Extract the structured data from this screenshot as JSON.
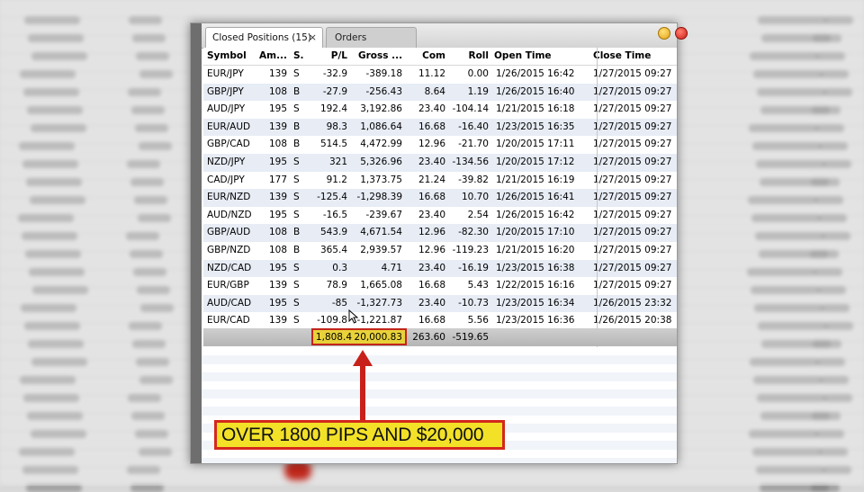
{
  "tabs": {
    "closed_positions": "Closed Positions (15)",
    "close_glyph": "×",
    "orders": "Orders"
  },
  "columns": {
    "symbol": "Symbol",
    "amount": "Am...",
    "side": "S.",
    "pl": "P/L",
    "gross": "Gross ...",
    "com": "Com",
    "roll": "Roll",
    "open_time": "Open Time",
    "close_time": "Close Time"
  },
  "rows": [
    {
      "symbol": "EUR/JPY",
      "amount": "139",
      "side": "S",
      "pl": "-32.9",
      "gross": "-389.18",
      "com": "11.12",
      "roll": "0.00",
      "open": "1/26/2015 16:42",
      "close": "1/27/2015 09:27"
    },
    {
      "symbol": "GBP/JPY",
      "amount": "108",
      "side": "B",
      "pl": "-27.9",
      "gross": "-256.43",
      "com": "8.64",
      "roll": "1.19",
      "open": "1/26/2015 16:40",
      "close": "1/27/2015 09:27"
    },
    {
      "symbol": "AUD/JPY",
      "amount": "195",
      "side": "S",
      "pl": "192.4",
      "gross": "3,192.86",
      "com": "23.40",
      "roll": "-104.14",
      "open": "1/21/2015 16:18",
      "close": "1/27/2015 09:27"
    },
    {
      "symbol": "EUR/AUD",
      "amount": "139",
      "side": "B",
      "pl": "98.3",
      "gross": "1,086.64",
      "com": "16.68",
      "roll": "-16.40",
      "open": "1/23/2015 16:35",
      "close": "1/27/2015 09:27"
    },
    {
      "symbol": "GBP/CAD",
      "amount": "108",
      "side": "B",
      "pl": "514.5",
      "gross": "4,472.99",
      "com": "12.96",
      "roll": "-21.70",
      "open": "1/20/2015 17:11",
      "close": "1/27/2015 09:27"
    },
    {
      "symbol": "NZD/JPY",
      "amount": "195",
      "side": "S",
      "pl": "321",
      "gross": "5,326.96",
      "com": "23.40",
      "roll": "-134.56",
      "open": "1/20/2015 17:12",
      "close": "1/27/2015 09:27"
    },
    {
      "symbol": "CAD/JPY",
      "amount": "177",
      "side": "S",
      "pl": "91.2",
      "gross": "1,373.75",
      "com": "21.24",
      "roll": "-39.82",
      "open": "1/21/2015 16:19",
      "close": "1/27/2015 09:27"
    },
    {
      "symbol": "EUR/NZD",
      "amount": "139",
      "side": "S",
      "pl": "-125.4",
      "gross": "-1,298.39",
      "com": "16.68",
      "roll": "10.70",
      "open": "1/26/2015 16:41",
      "close": "1/27/2015 09:27"
    },
    {
      "symbol": "AUD/NZD",
      "amount": "195",
      "side": "S",
      "pl": "-16.5",
      "gross": "-239.67",
      "com": "23.40",
      "roll": "2.54",
      "open": "1/26/2015 16:42",
      "close": "1/27/2015 09:27"
    },
    {
      "symbol": "GBP/AUD",
      "amount": "108",
      "side": "B",
      "pl": "543.9",
      "gross": "4,671.54",
      "com": "12.96",
      "roll": "-82.30",
      "open": "1/20/2015 17:10",
      "close": "1/27/2015 09:27"
    },
    {
      "symbol": "GBP/NZD",
      "amount": "108",
      "side": "B",
      "pl": "365.4",
      "gross": "2,939.57",
      "com": "12.96",
      "roll": "-119.23",
      "open": "1/21/2015 16:20",
      "close": "1/27/2015 09:27"
    },
    {
      "symbol": "NZD/CAD",
      "amount": "195",
      "side": "S",
      "pl": "0.3",
      "gross": "4.71",
      "com": "23.40",
      "roll": "-16.19",
      "open": "1/23/2015 16:38",
      "close": "1/27/2015 09:27"
    },
    {
      "symbol": "EUR/GBP",
      "amount": "139",
      "side": "S",
      "pl": "78.9",
      "gross": "1,665.08",
      "com": "16.68",
      "roll": "5.43",
      "open": "1/22/2015 16:16",
      "close": "1/27/2015 09:27"
    },
    {
      "symbol": "AUD/CAD",
      "amount": "195",
      "side": "S",
      "pl": "-85",
      "gross": "-1,327.73",
      "com": "23.40",
      "roll": "-10.73",
      "open": "1/23/2015 16:34",
      "close": "1/26/2015 23:32"
    },
    {
      "symbol": "EUR/CAD",
      "amount": "139",
      "side": "S",
      "pl": "-109.8",
      "gross": "-1,221.87",
      "com": "16.68",
      "roll": "5.56",
      "open": "1/23/2015 16:36",
      "close": "1/26/2015 20:38"
    }
  ],
  "totals": {
    "pl": "1,808.4",
    "gross": "20,000.83",
    "com": "263.60",
    "roll": "-519.65"
  },
  "annotation": {
    "banner_text": "OVER 1800 PIPS AND $20,000",
    "highlight_color": "#e8d23a",
    "border_color": "#c2251a",
    "arrow_color": "#c8201a"
  }
}
